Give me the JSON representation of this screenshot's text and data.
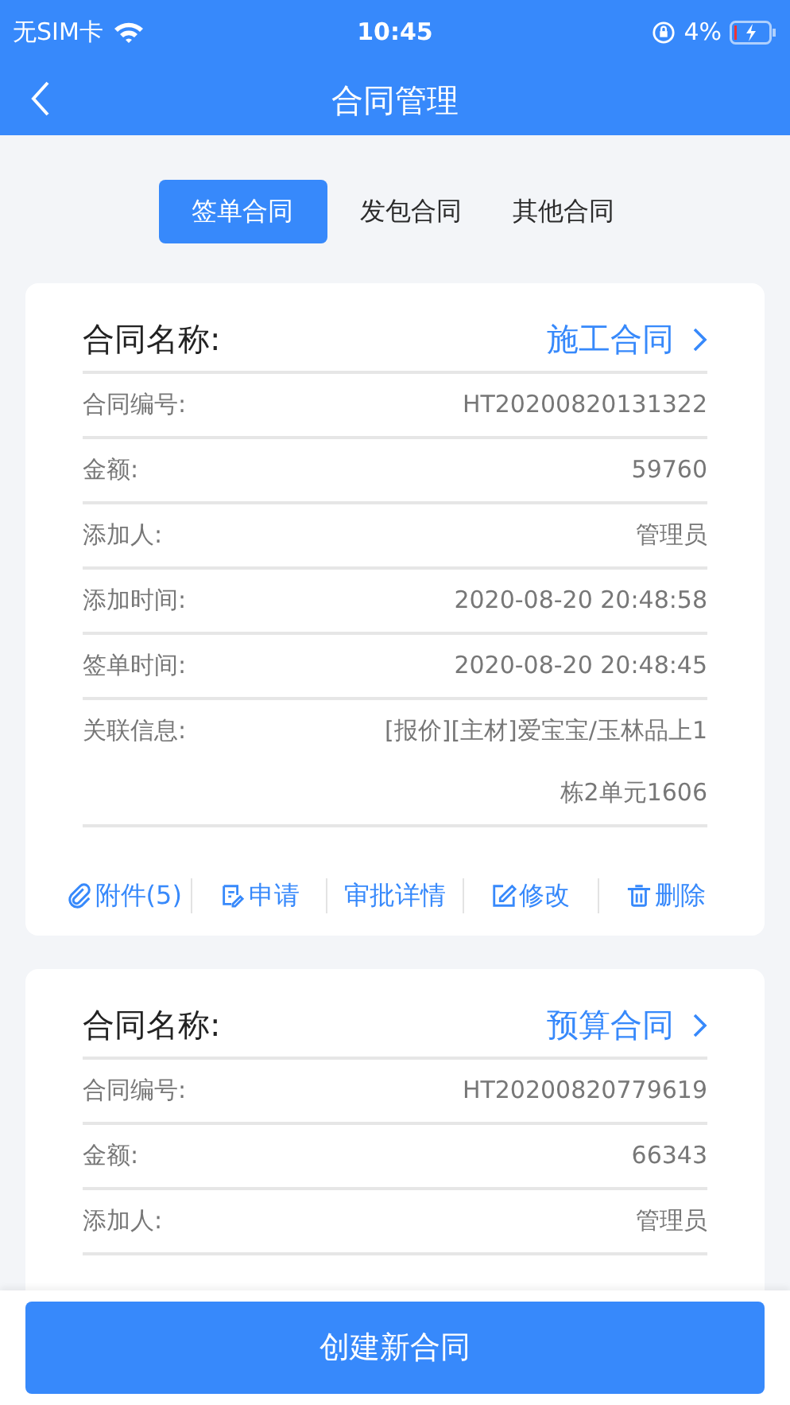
{
  "status_bar": {
    "carrier": "无SIM卡",
    "time": "10:45",
    "battery": "4%"
  },
  "nav": {
    "title": "合同管理"
  },
  "tabs": [
    {
      "label": "签单合同",
      "selected": true
    },
    {
      "label": "发包合同",
      "selected": false
    },
    {
      "label": "其他合同",
      "selected": false
    }
  ],
  "contracts": [
    {
      "name_label": "合同名称:",
      "name": "施工合同",
      "fields": [
        {
          "label": "合同编号:",
          "value": "HT20200820131322"
        },
        {
          "label": "金额:",
          "value": "59760"
        },
        {
          "label": "添加人:",
          "value": "管理员"
        },
        {
          "label": "添加时间:",
          "value": "2020-08-20 20:48:58"
        },
        {
          "label": "签单时间:",
          "value": "2020-08-20 20:48:45"
        },
        {
          "label": "关联信息:",
          "value": "[报价][主材]爱宝宝/玉林品上1栋2单元1606"
        }
      ],
      "actions": [
        {
          "kind": "attach",
          "label": "附件(5)"
        },
        {
          "kind": "apply",
          "label": "申请"
        },
        {
          "kind": "detail",
          "label": "审批详情"
        },
        {
          "kind": "edit",
          "label": "修改"
        },
        {
          "kind": "delete",
          "label": "删除"
        }
      ]
    },
    {
      "name_label": "合同名称:",
      "name": "预算合同",
      "fields": [
        {
          "label": "合同编号:",
          "value": "HT20200820779619"
        },
        {
          "label": "金额:",
          "value": "66343"
        },
        {
          "label": "添加人:",
          "value": "管理员"
        }
      ]
    }
  ],
  "create_button": "创建新合同"
}
